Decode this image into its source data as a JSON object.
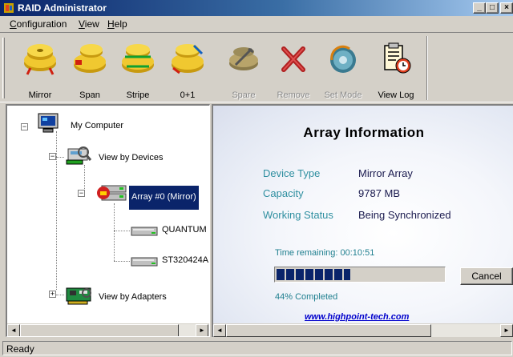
{
  "window": {
    "title": "RAID Administrator",
    "controls": {
      "minimize": "_",
      "maximize": "□",
      "close": "×"
    }
  },
  "menu": [
    {
      "label": "Configuration",
      "accel": "C"
    },
    {
      "label": "View",
      "accel": "V"
    },
    {
      "label": "Help",
      "accel": "H"
    }
  ],
  "toolbar": [
    {
      "label": "Mirror",
      "icon": "disks-mirror-icon",
      "enabled": true
    },
    {
      "label": "Span",
      "icon": "disks-span-icon",
      "enabled": true
    },
    {
      "label": "Stripe",
      "icon": "disks-stripe-icon",
      "enabled": true
    },
    {
      "label": "0+1",
      "icon": "disks-raid01-icon",
      "enabled": true
    },
    {
      "label": "Spare",
      "icon": "spare-disk-icon",
      "enabled": false
    },
    {
      "label": "Remove",
      "icon": "remove-x-icon",
      "enabled": false
    },
    {
      "label": "Set Mode",
      "icon": "set-mode-icon",
      "enabled": false
    },
    {
      "label": "View Log",
      "icon": "view-log-icon",
      "enabled": true
    }
  ],
  "tree": {
    "root": "My Computer",
    "devices": "View by Devices",
    "array": "Array #0 (Mirror)",
    "disk1": "QUANTUM",
    "disk2": "ST320424A",
    "adapters": "View by Adapters",
    "collapse_glyph": "−",
    "expand_glyph": "+"
  },
  "array_info": {
    "heading": "Array Information",
    "rows": [
      {
        "key": "Device Type",
        "value": "Mirror Array"
      },
      {
        "key": "Capacity",
        "value": "9787 MB"
      },
      {
        "key": "Working Status",
        "value": "Being Synchronized"
      }
    ],
    "time_remaining": "Time remaining:  00:10:51",
    "progress_fraction": 0.44,
    "percent_text": "44% Completed",
    "cancel_label": "Cancel",
    "link": "www.highpoint-tech.com"
  },
  "scroll_glyphs": {
    "left": "◄",
    "right": "►"
  },
  "status": {
    "text": "Ready"
  },
  "colors": {
    "titlebar_start": "#0a246a",
    "selection": "#0a246a",
    "info_key": "#2f8fa0",
    "link": "#0000cc"
  }
}
